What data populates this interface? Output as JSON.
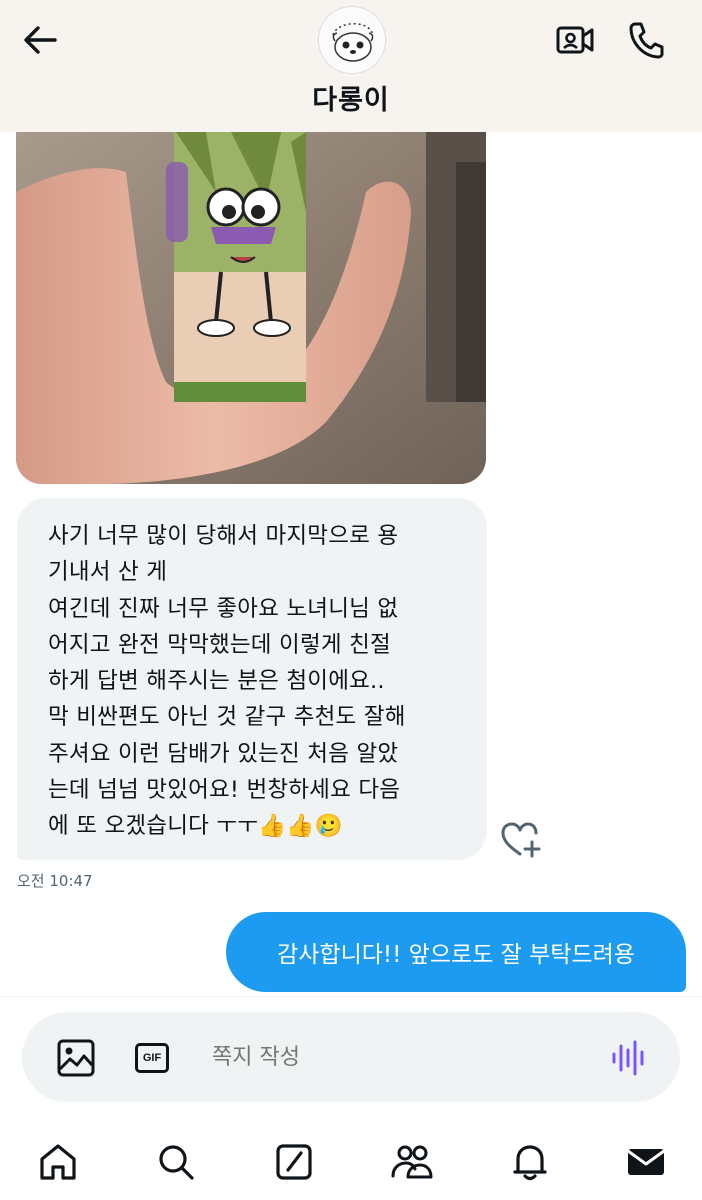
{
  "header": {
    "title": "다롱이",
    "back_icon": "arrow-left-icon",
    "video_icon": "video-call-icon",
    "call_icon": "phone-icon"
  },
  "messages": {
    "received": {
      "lines": [
        "사기 너무 많이 당해서 마지막으로 용",
        "기내서 산 게",
        "여긴데 진짜 너무 좋아요 노녀니님 없",
        "어지고 완전 막막했는데 이렇게 친절",
        "하게 답변 해주시는 분은 첨이에요..",
        "막 비싼편도 아닌 것 같구 추천도 잘해",
        "주셔요 이런 담배가 있는진 처음 알았",
        "는데 넘넘 맛있어요! 번창하세요 다음",
        "에 또 오겠습니다 ㅜㅜ👍👍🥲"
      ],
      "time": "오전 10:47"
    },
    "sent": {
      "text": "감사합니다!! 앞으로도 잘 부탁드려용"
    }
  },
  "composer": {
    "placeholder": "쪽지 작성",
    "gif_label": "GIF"
  },
  "nav": {
    "items": [
      "home-icon",
      "search-icon",
      "compose-icon",
      "communities-icon",
      "notifications-icon",
      "messages-icon"
    ]
  },
  "colors": {
    "accent": "#1d9bf0",
    "bubble_in": "#eff3f4",
    "header_bg": "#f7f4f0",
    "voice": "#7856ff"
  }
}
